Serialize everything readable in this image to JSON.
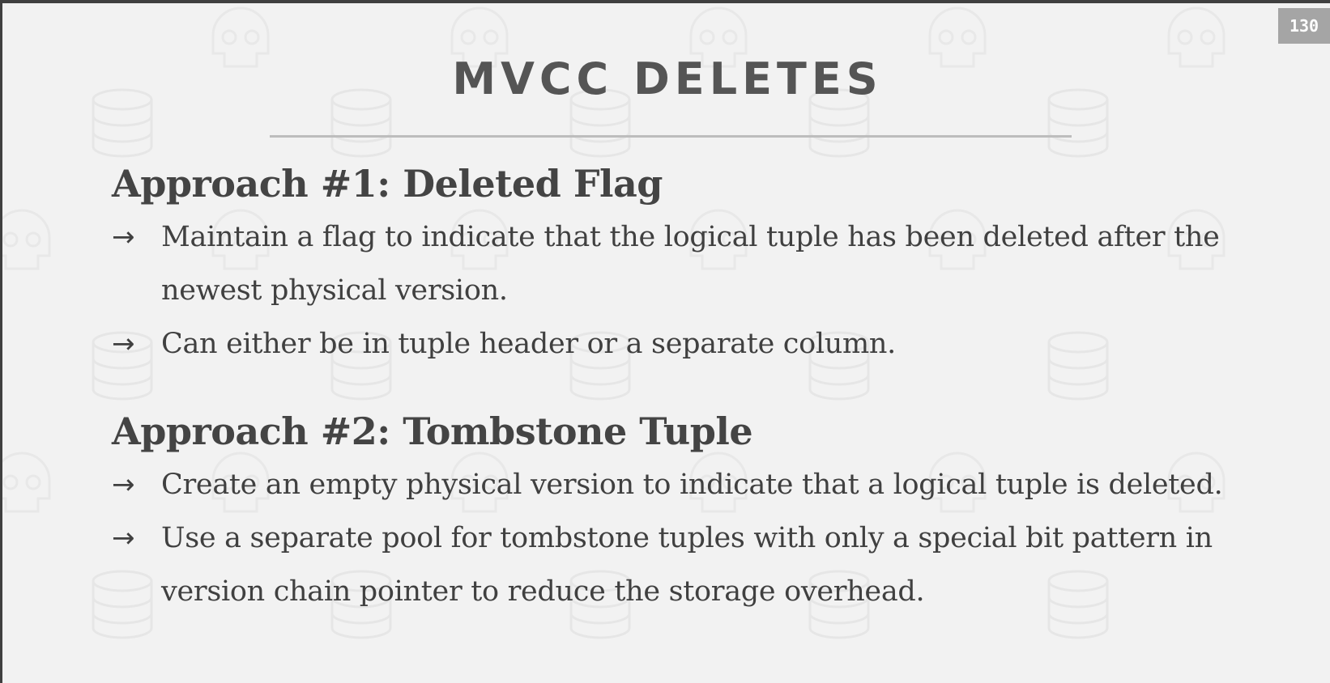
{
  "page_number": "130",
  "title": "MVCC DELETES",
  "sections": [
    {
      "heading": "Approach #1: Deleted Flag",
      "bullets": [
        "Maintain a flag to indicate that the logical tuple has been deleted after the newest physical version.",
        "Can either be in tuple header or a separate column."
      ]
    },
    {
      "heading": "Approach #2: Tombstone Tuple",
      "bullets": [
        "Create an empty physical version to indicate that a logical tuple is deleted.",
        "Use a separate pool for tombstone tuples with only a special bit pattern in version chain pointer to reduce the storage overhead."
      ]
    }
  ],
  "bullet_symbol": "→",
  "watermark_icons": [
    "database-icon",
    "skull-icon"
  ],
  "colors": {
    "background": "#f2f2f2",
    "text": "#444444",
    "page_number_bg": "#a5a5a5",
    "rule": "#bdbdbd"
  }
}
